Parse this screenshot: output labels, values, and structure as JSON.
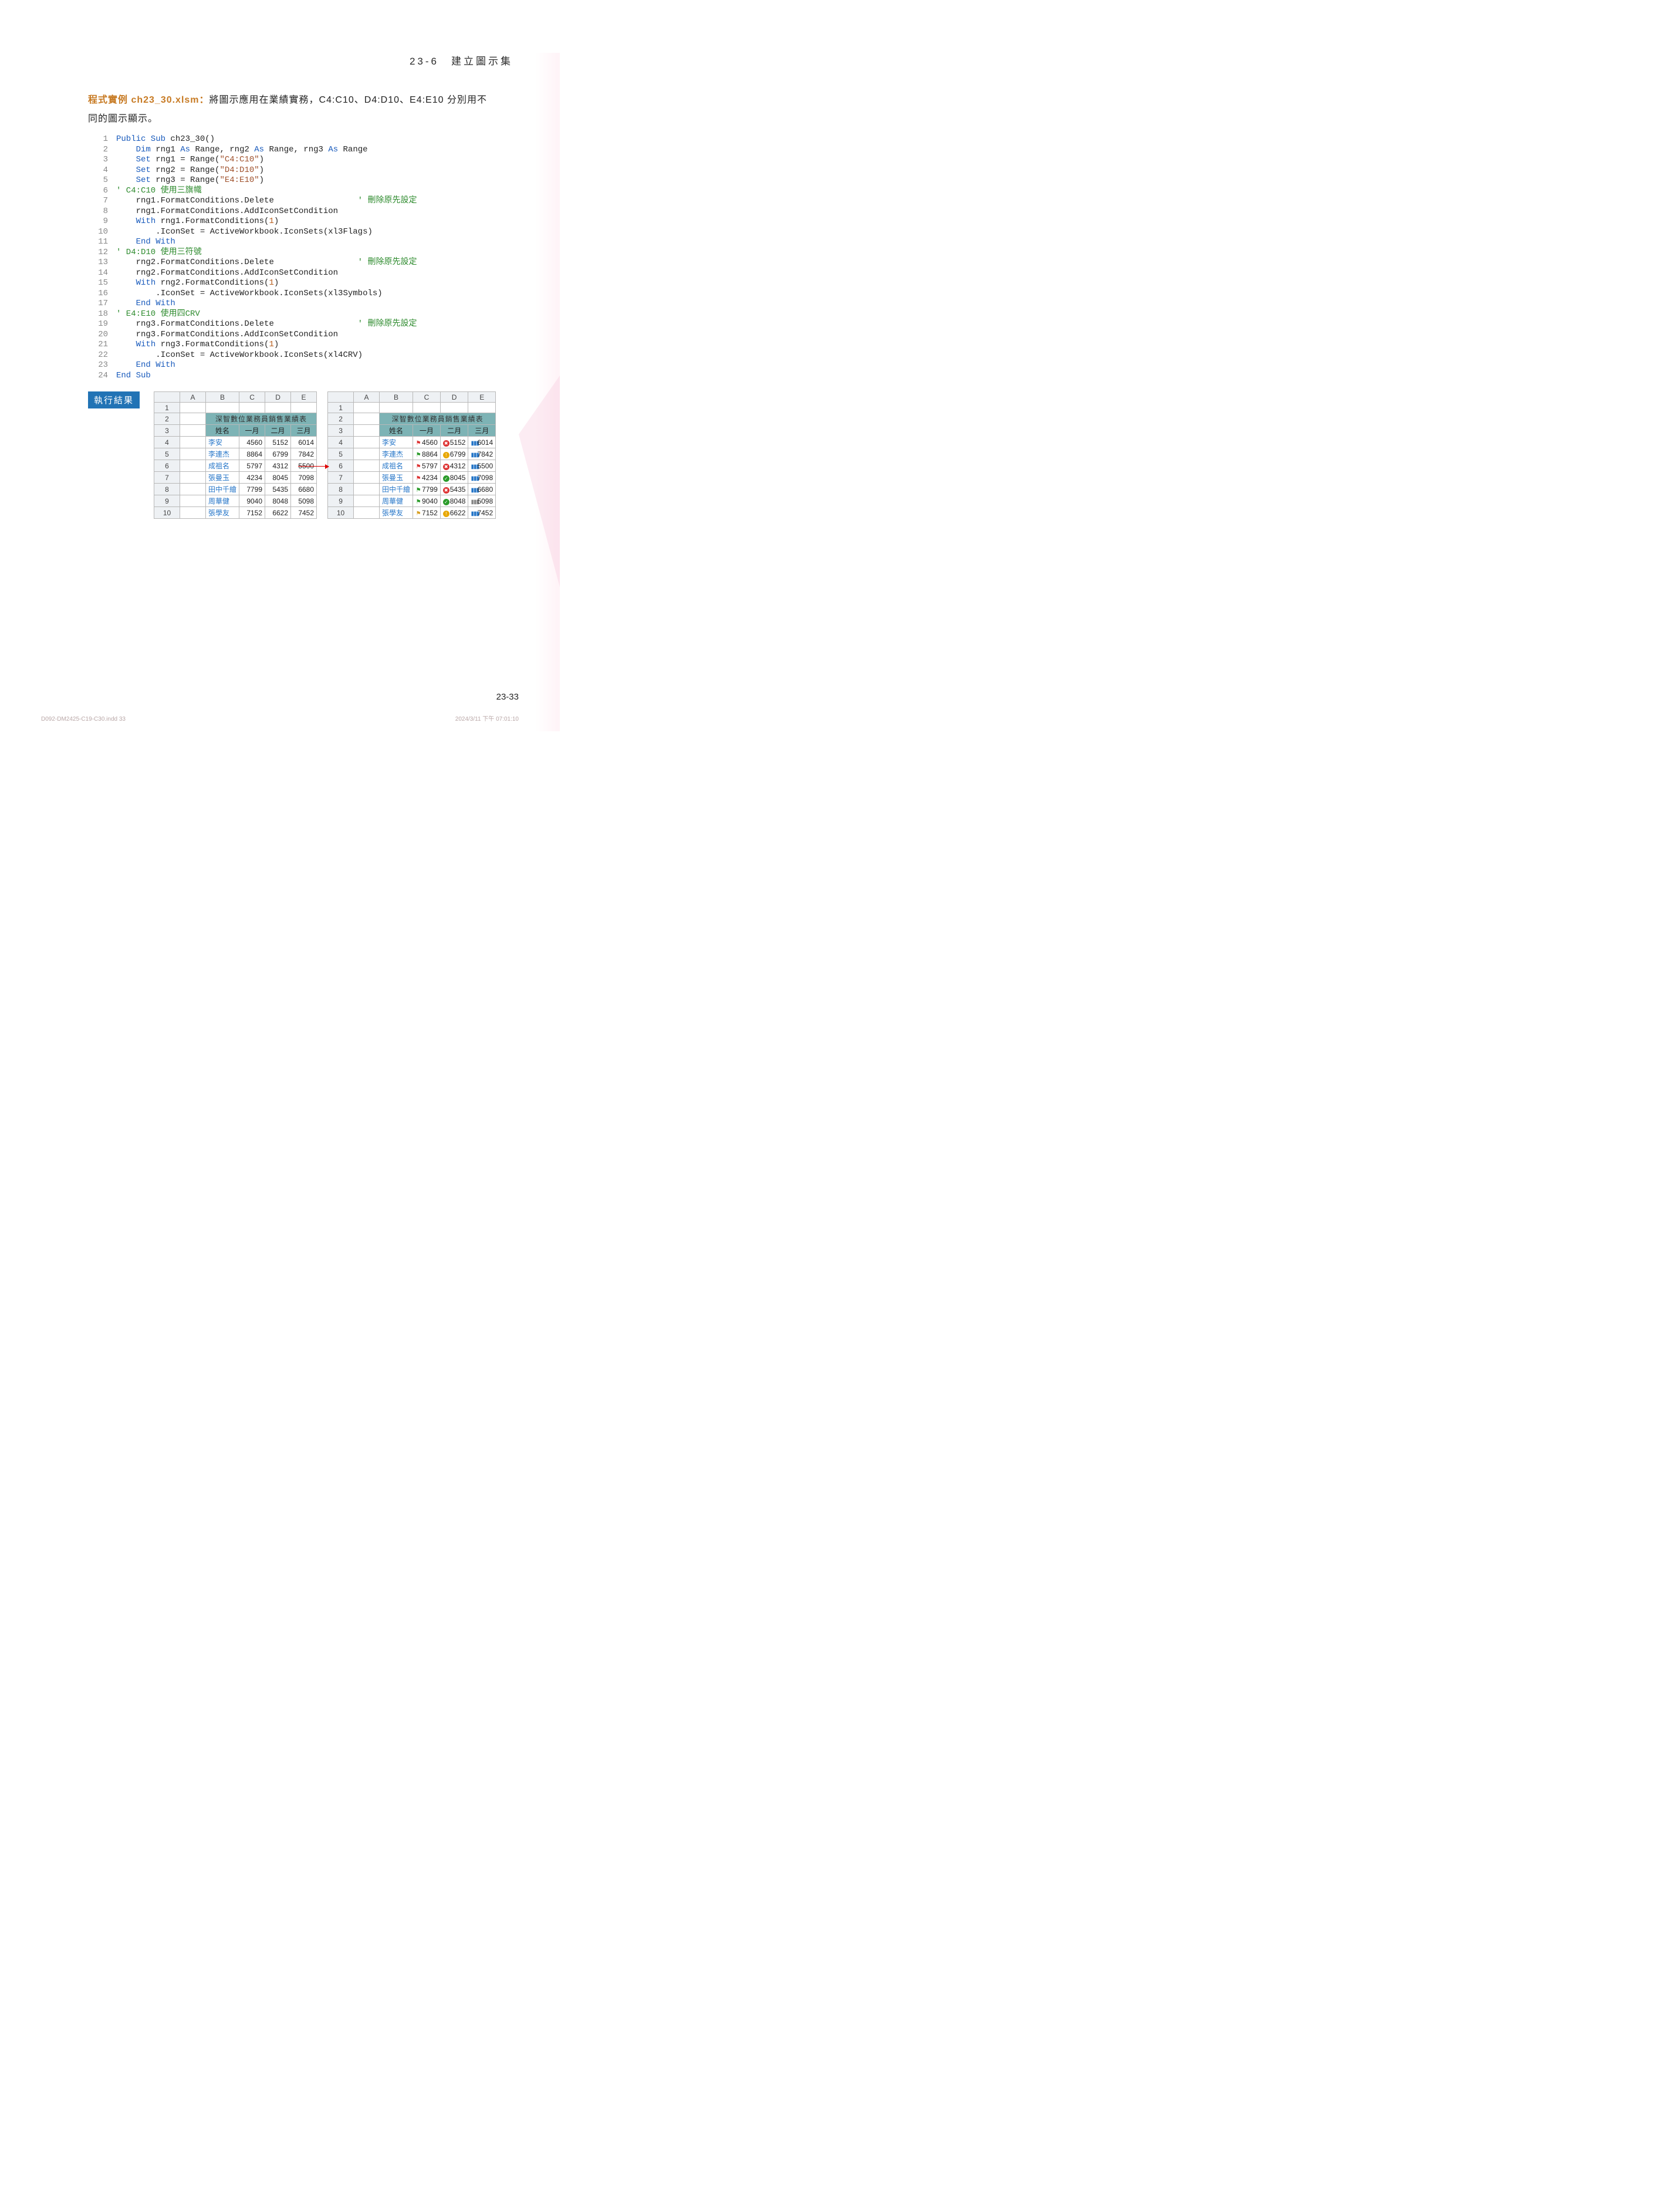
{
  "header": {
    "section": "23-6　建立圖示集"
  },
  "intro": {
    "label": "程式實例 ch23_30.xlsm：",
    "text_a": "將圖示應用在業績實務，C4:C10、D4:D10、E4:E10 分別用不",
    "text_b": "同的圖示顯示。"
  },
  "code": [
    {
      "n": 1,
      "html": "<span class='kw-blue'>Public Sub</span> ch23_30()"
    },
    {
      "n": 2,
      "html": "    <span class='kw-blue'>Dim</span> rng1 <span class='kw-blue'>As</span> Range, rng2 <span class='kw-blue'>As</span> Range, rng3 <span class='kw-blue'>As</span> Range"
    },
    {
      "n": 3,
      "html": "    <span class='kw-blue'>Set</span> rng1 = Range(<span class='kw-brown'>\"C4:C10\"</span>)"
    },
    {
      "n": 4,
      "html": "    <span class='kw-blue'>Set</span> rng2 = Range(<span class='kw-brown'>\"D4:D10\"</span>)"
    },
    {
      "n": 5,
      "html": "    <span class='kw-blue'>Set</span> rng3 = Range(<span class='kw-brown'>\"E4:E10\"</span>)"
    },
    {
      "n": 6,
      "html": "<span class='kw-green'>' C4:C10 使用三旗幟</span>"
    },
    {
      "n": 7,
      "html": "    rng1.FormatConditions.Delete                 <span class='kw-green'>' 刪除原先設定</span>"
    },
    {
      "n": 8,
      "html": "    rng1.FormatConditions.AddIconSetCondition"
    },
    {
      "n": 9,
      "html": "    <span class='kw-blue'>With</span> rng1.FormatConditions(<span class='num'>1</span>)"
    },
    {
      "n": 10,
      "html": "        .IconSet = ActiveWorkbook.IconSets(xl3Flags)"
    },
    {
      "n": 11,
      "html": "    <span class='kw-blue'>End With</span>"
    },
    {
      "n": 12,
      "html": "<span class='kw-green'>' D4:D10 使用三符號</span>"
    },
    {
      "n": 13,
      "html": "    rng2.FormatConditions.Delete                 <span class='kw-green'>' 刪除原先設定</span>"
    },
    {
      "n": 14,
      "html": "    rng2.FormatConditions.AddIconSetCondition"
    },
    {
      "n": 15,
      "html": "    <span class='kw-blue'>With</span> rng2.FormatConditions(<span class='num'>1</span>)"
    },
    {
      "n": 16,
      "html": "        .IconSet = ActiveWorkbook.IconSets(xl3Symbols)"
    },
    {
      "n": 17,
      "html": "    <span class='kw-blue'>End With</span>"
    },
    {
      "n": 18,
      "html": "<span class='kw-green'>' E4:E10 使用四CRV</span>"
    },
    {
      "n": 19,
      "html": "    rng3.FormatConditions.Delete                 <span class='kw-green'>' 刪除原先設定</span>"
    },
    {
      "n": 20,
      "html": "    rng3.FormatConditions.AddIconSetCondition"
    },
    {
      "n": 21,
      "html": "    <span class='kw-blue'>With</span> rng3.FormatConditions(<span class='num'>1</span>)"
    },
    {
      "n": 22,
      "html": "        .IconSet = ActiveWorkbook.IconSets(xl4CRV)"
    },
    {
      "n": 23,
      "html": "    <span class='kw-blue'>End With</span>"
    },
    {
      "n": 24,
      "html": "<span class='kw-blue'>End Sub</span>"
    }
  ],
  "result_label": "執行結果",
  "sheet": {
    "col_letters": [
      "A",
      "B",
      "C",
      "D",
      "E"
    ],
    "title": "深智數位業務員銷售業績表",
    "headers": [
      "姓名",
      "一月",
      "二月",
      "三月"
    ],
    "rows": [
      {
        "name": "李安",
        "c": 4560,
        "d": 5152,
        "e": 6014,
        "fc": "r",
        "sd": "x",
        "be": "b"
      },
      {
        "name": "李連杰",
        "c": 8864,
        "d": 6799,
        "e": 7842,
        "fc": "g",
        "sd": "e",
        "be": "b"
      },
      {
        "name": "成祖名",
        "c": 5797,
        "d": 4312,
        "e": 5500,
        "fc": "r",
        "sd": "x",
        "be": "b"
      },
      {
        "name": "張曼玉",
        "c": 4234,
        "d": 8045,
        "e": 7098,
        "fc": "r",
        "sd": "c",
        "be": "b"
      },
      {
        "name": "田中千繪",
        "c": 7799,
        "d": 5435,
        "e": 6680,
        "fc": "g",
        "sd": "x",
        "be": "b"
      },
      {
        "name": "周華健",
        "c": 9040,
        "d": 8048,
        "e": 5098,
        "fc": "g",
        "sd": "c",
        "be": "g"
      },
      {
        "name": "張學友",
        "c": 7152,
        "d": 6622,
        "e": 7452,
        "fc": "y",
        "sd": "e",
        "be": "b"
      }
    ]
  },
  "footer": {
    "page": "23-33"
  },
  "meta": {
    "left": "D092-DM2425-C19-C30.indd   33",
    "right": "2024/3/11   下午 07:01:10"
  }
}
